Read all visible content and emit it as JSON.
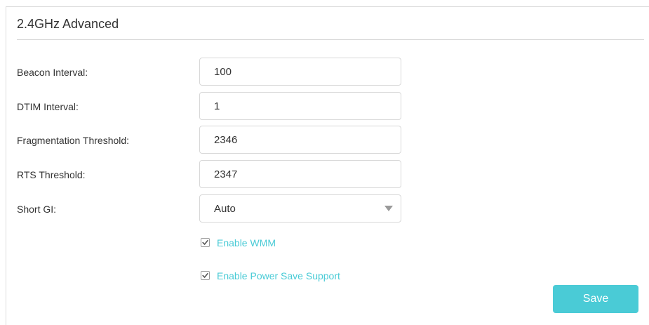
{
  "section": {
    "title": "2.4GHz Advanced"
  },
  "fields": {
    "beacon_interval": {
      "label": "Beacon Interval:",
      "value": "100"
    },
    "dtim_interval": {
      "label": "DTIM Interval:",
      "value": "1"
    },
    "fragmentation_threshold": {
      "label": "Fragmentation Threshold:",
      "value": "2346"
    },
    "rts_threshold": {
      "label": "RTS Threshold:",
      "value": "2347"
    },
    "short_gi": {
      "label": "Short GI:",
      "selected": "Auto"
    }
  },
  "checkboxes": {
    "enable_wmm": {
      "label": "Enable WMM",
      "checked": true
    },
    "enable_power_save": {
      "label": "Enable Power Save Support",
      "checked": true
    }
  },
  "actions": {
    "save_label": "Save"
  },
  "colors": {
    "accent": "#4acbd6",
    "text": "#333333",
    "border": "#d8d8d8"
  },
  "icons": {
    "select_arrow": "chevron-down-icon",
    "checkbox_mark": "checkmark-icon"
  }
}
